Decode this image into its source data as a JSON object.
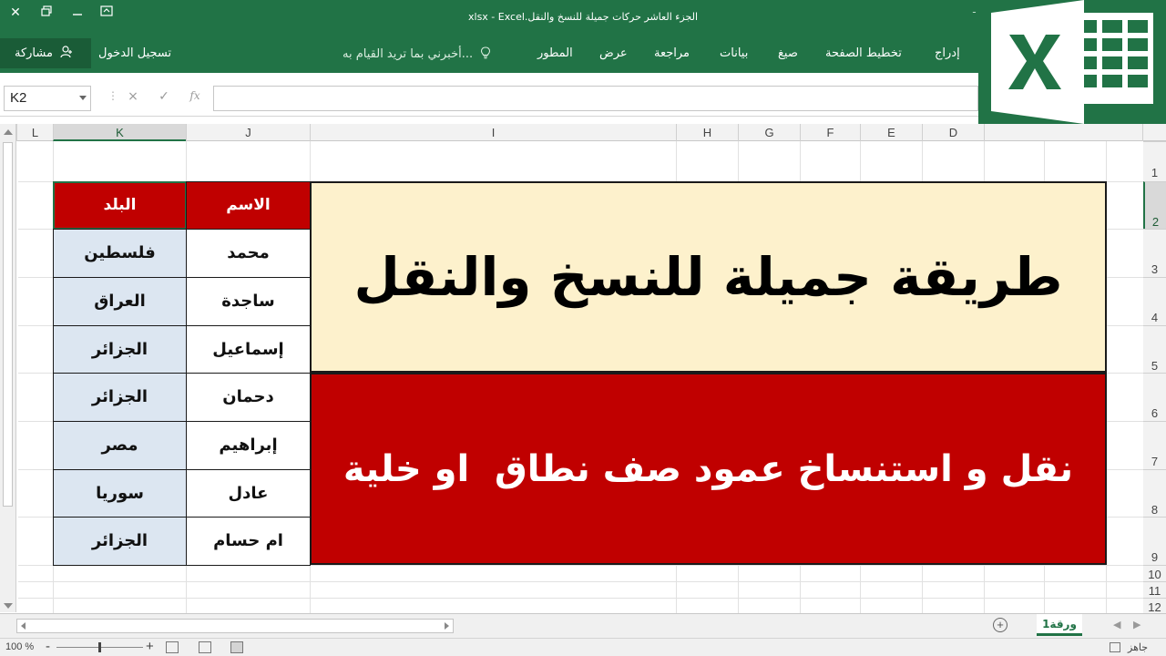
{
  "window": {
    "title": "الجزء العاشر حركات جميلة للنسخ والنقل.xlsx - Excel",
    "title_extra": "ـ"
  },
  "ribbon": {
    "tabs": [
      {
        "label": "إدراج",
        "name": "insert"
      },
      {
        "label": "تخطيط الصفحة",
        "name": "page-layout"
      },
      {
        "label": "صيغ",
        "name": "formulas"
      },
      {
        "label": "بيانات",
        "name": "data"
      },
      {
        "label": "مراجعة",
        "name": "review"
      },
      {
        "label": "عرض",
        "name": "view"
      },
      {
        "label": "المطور",
        "name": "developer"
      }
    ],
    "tell_me": "أخبرني بما تريد القيام به...",
    "sign_in": "تسجيل الدخول",
    "share": "مشاركة"
  },
  "formula_bar": {
    "name_box": "K2",
    "cancel_icon": "×",
    "enter_icon": "✓",
    "fx_icon": "fx",
    "separator": "⋮",
    "value": ""
  },
  "columns": [
    "L",
    "K",
    "J",
    "I",
    "H",
    "G",
    "F",
    "E",
    "D"
  ],
  "selected_column": "K",
  "rows": [
    "1",
    "2",
    "3",
    "4",
    "5",
    "6",
    "7",
    "8",
    "9",
    "10",
    "11",
    "12"
  ],
  "selected_row": "2",
  "table": {
    "header_name": "الاسم",
    "header_country": "البلد",
    "rows": [
      {
        "name": "محمد",
        "country": "فلسطين"
      },
      {
        "name": "ساجدة",
        "country": "العراق"
      },
      {
        "name": "إسماعيل",
        "country": "الجزائر"
      },
      {
        "name": "دحمان",
        "country": "الجزائر"
      },
      {
        "name": "إبراهيم",
        "country": "مصر"
      },
      {
        "name": "عادل",
        "country": "سوريا"
      },
      {
        "name": "ام حسام",
        "country": "الجزائر"
      }
    ]
  },
  "banner": {
    "title": "طريقة جميلة للنسخ والنقل",
    "subtitle": "نقل و استنساخ عمود صف نطاق  او خلية"
  },
  "sheet_tabs": {
    "active": "ورقة1",
    "add": "+",
    "prev": "◀",
    "next": "▶"
  },
  "status_bar": {
    "ready": "جاهز",
    "zoom_label": "100 %",
    "zoom_minus": "-",
    "zoom_plus": "+",
    "zoom_percent": 100
  },
  "colors": {
    "excel_green": "#217346",
    "header_red": "#c00000",
    "banner_cream": "#fdf1cc",
    "country_blue": "#dce6f1"
  },
  "icons": {
    "close": "close-icon",
    "restore": "restore-icon",
    "minimize": "minimize-icon",
    "ribbon_display": "ribbon-display-icon",
    "user": "add-user-icon",
    "bulb": "lightbulb-icon",
    "logo": "excel-logo-icon"
  }
}
